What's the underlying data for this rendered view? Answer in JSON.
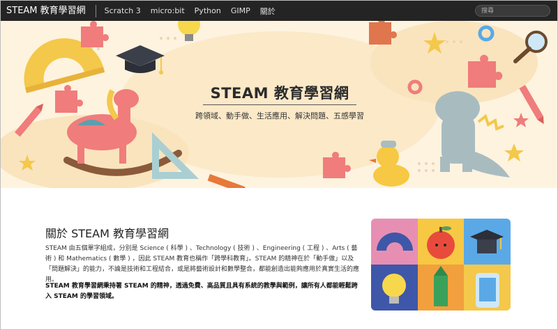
{
  "navbar": {
    "brand": "STEAM 教育學習網",
    "links": [
      "Scratch 3",
      "micro:bit",
      "Python",
      "GIMP",
      "關於"
    ],
    "search_placeholder": "搜尋"
  },
  "hero": {
    "title": "STEAM 教育學習網",
    "subtitle": "跨領域、動手做、生活應用、解決問題、五感學習"
  },
  "about": {
    "title": "關於 STEAM 教育學習網",
    "paragraph1": "STEAM 由五個單字組成，分別是 Science ( 科學 ) 、Technology ( 技術 ) 、Engineering ( 工程 ) 、Arts ( 藝術 ) 和 Mathematics ( 數學 ) ，因此 STEAM 教育也稱作「跨學科教育」。STEAM 的精神在於「動手做」以及「問題解決」的能力，不論是技術和工程結合，或是將藝術設計和數學整合，都能創造出能夠應用於真實生活的應用。",
    "paragraph2": "STEAM 教育學習網秉持著 STEAM 的精神，透過免費、高品質且具有系統的教學與範例，讓所有人都能輕鬆跨入 STEAM 的學習領域。"
  },
  "colors": {
    "navbar": "#242424",
    "hero_bg": "#fdf3df",
    "puzzle": "#f07c7c",
    "star": "#f4c84a"
  }
}
